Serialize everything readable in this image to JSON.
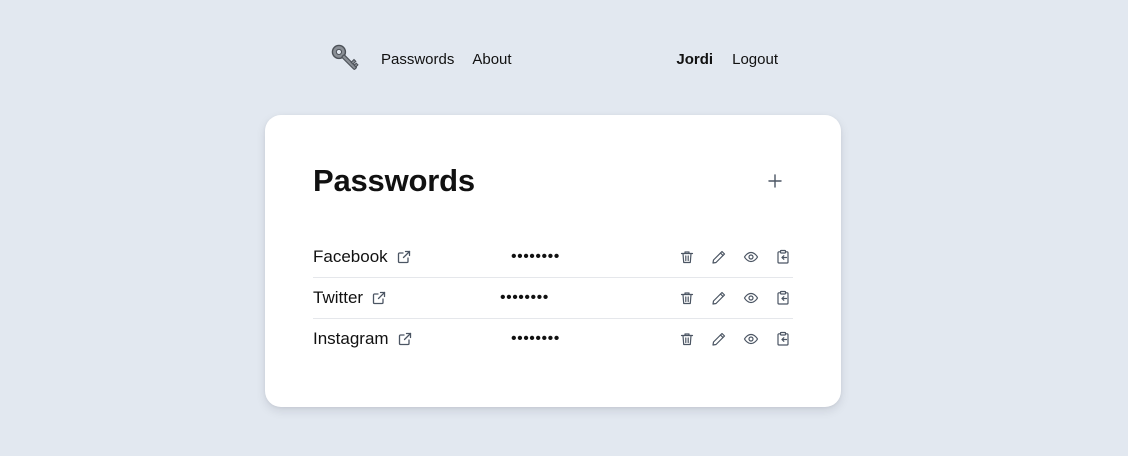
{
  "nav": {
    "logo_icon": "key-icon",
    "links": [
      {
        "label": "Passwords"
      },
      {
        "label": "About"
      }
    ],
    "user_name": "Jordi",
    "logout_label": "Logout"
  },
  "page": {
    "title": "Passwords",
    "add_icon": "plus-icon"
  },
  "passwords": [
    {
      "name": "Facebook",
      "masked_password": "••••••••"
    },
    {
      "name": "Twitter",
      "masked_password": "••••••••"
    },
    {
      "name": "Instagram",
      "masked_password": "••••••••"
    }
  ],
  "row_action_icons": [
    "trash-icon",
    "pencil-icon",
    "eye-icon",
    "clipboard-icon"
  ],
  "colors": {
    "background": "#e2e8f0",
    "card": "#ffffff",
    "text": "#111111",
    "icon": "#4b5563",
    "divider": "#e5e7eb"
  }
}
